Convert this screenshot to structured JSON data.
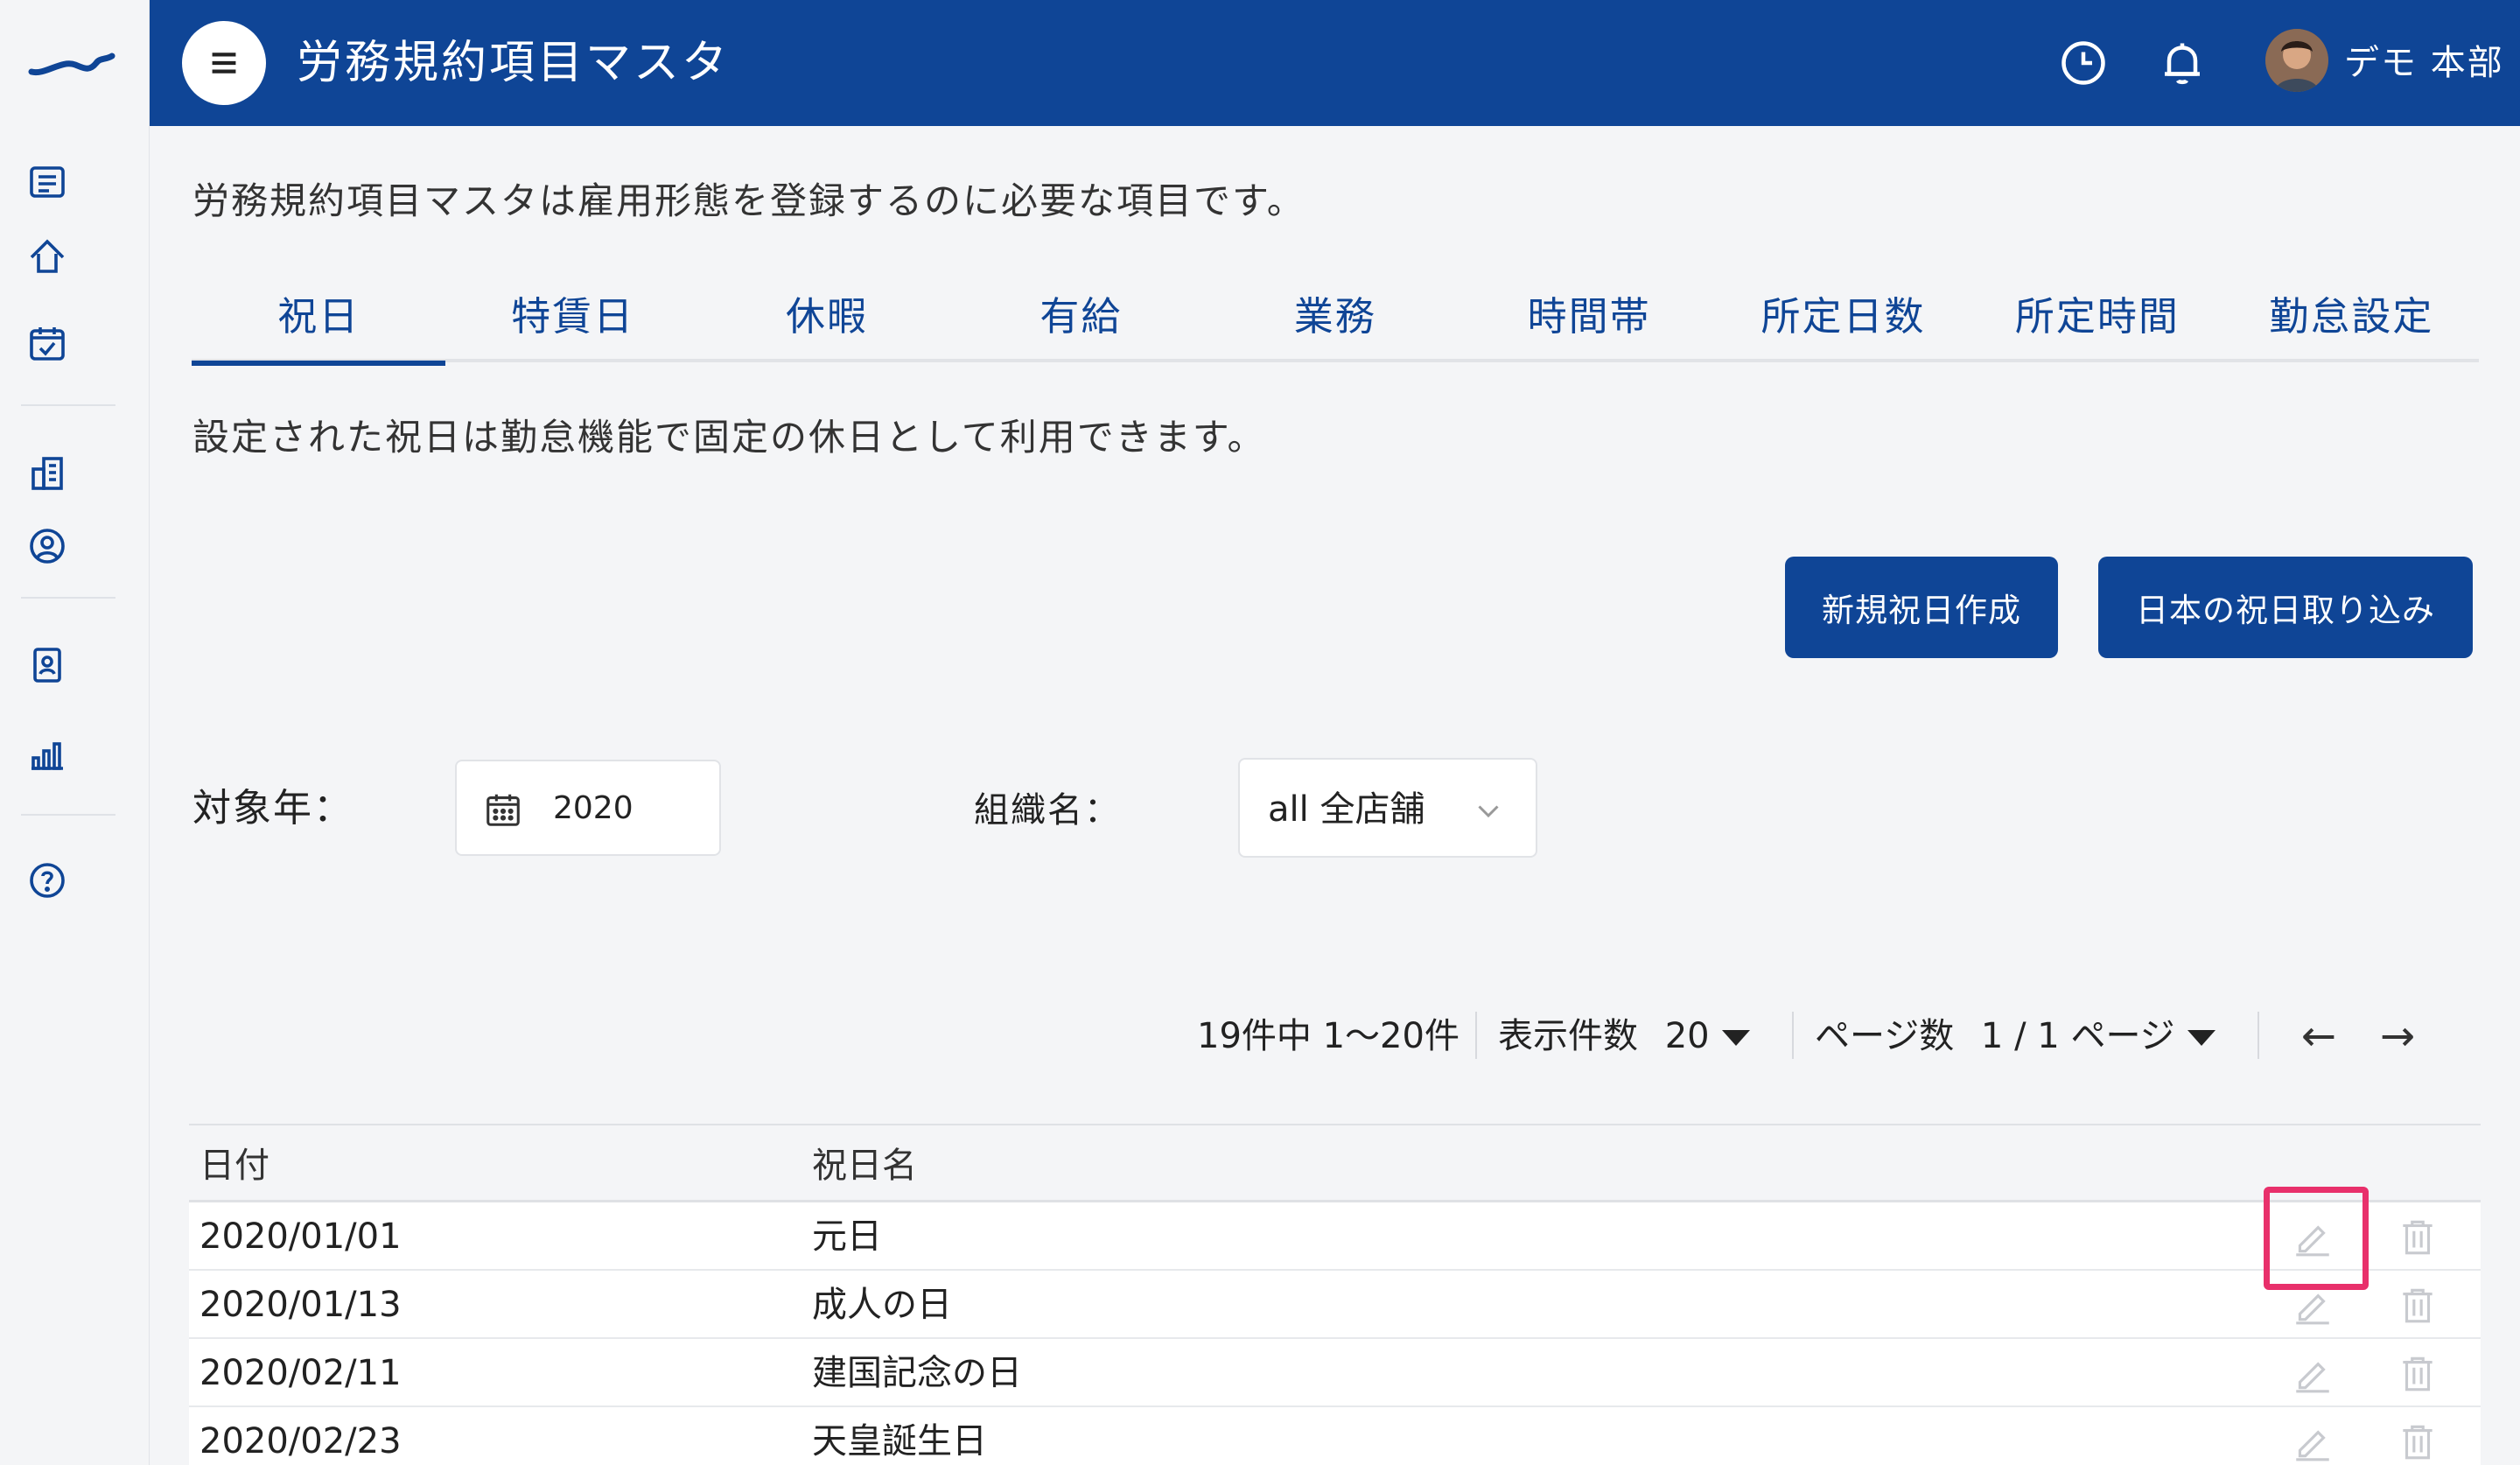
{
  "header": {
    "title": "労務規約項目マスタ",
    "user_name": "デモ 本部"
  },
  "intro": "労務規約項目マスタは雇用形態を登録するのに必要な項目です。",
  "tabs": [
    {
      "label": "祝日",
      "active": true
    },
    {
      "label": "特賃日"
    },
    {
      "label": "休暇"
    },
    {
      "label": "有給"
    },
    {
      "label": "業務"
    },
    {
      "label": "時間帯"
    },
    {
      "label": "所定日数"
    },
    {
      "label": "所定時間"
    },
    {
      "label": "勤怠設定"
    }
  ],
  "description": "設定された祝日は勤怠機能で固定の休日として利用できます。",
  "buttons": {
    "new_holiday": "新規祝日作成",
    "import_japan": "日本の祝日取り込み"
  },
  "filters": {
    "year_label": "対象年：",
    "year_value": "2020",
    "org_label": "組織名：",
    "org_value": "all 全店舗"
  },
  "pager": {
    "summary": "19件中 1〜20件",
    "per_page_label": "表示件数",
    "per_page_value": "20",
    "page_label": "ページ数",
    "page_value": "1 / 1 ページ",
    "prev": "←",
    "next": "→"
  },
  "table": {
    "columns": [
      "日付",
      "祝日名"
    ],
    "rows": [
      {
        "date": "2020/01/01",
        "name": "元日"
      },
      {
        "date": "2020/01/13",
        "name": "成人の日"
      },
      {
        "date": "2020/02/11",
        "name": "建国記念の日"
      },
      {
        "date": "2020/02/23",
        "name": "天皇誕生日"
      }
    ]
  },
  "colors": {
    "primary": "#0f4596",
    "highlight": "#e8306b",
    "background": "#f4f5f7"
  }
}
